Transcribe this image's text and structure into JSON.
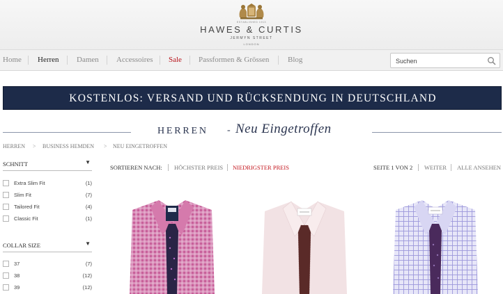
{
  "brand": {
    "established": "ESTABLISHED 1913",
    "name": "HAWES & CURTIS",
    "street": "JERMYN STREET",
    "city": "LONDON"
  },
  "nav": {
    "items": [
      {
        "label": "Home"
      },
      {
        "label": "Herren"
      },
      {
        "label": "Damen"
      },
      {
        "label": "Accessoires"
      },
      {
        "label": "Sale"
      },
      {
        "label": "Passformen & Grössen"
      },
      {
        "label": "Blog"
      }
    ],
    "active": "Herren",
    "search_placeholder": "Suchen"
  },
  "banner": {
    "text": "KOSTENLOS: VERSAND UND RÜCKSENDUNG IN DEUTSCHLAND"
  },
  "page_title": {
    "main": "HERREN",
    "dash": "-",
    "script": "Neu Eingetroffen"
  },
  "breadcrumb": {
    "items": [
      "HERREN",
      "BUSINESS HEMDEN",
      "NEU EINGETROFFEN"
    ],
    "separator": ">"
  },
  "filters": {
    "schnitt": {
      "title": "SCHNITT",
      "options": [
        {
          "label": "Extra Slim Fit",
          "count": "(1)"
        },
        {
          "label": "Slim Fit",
          "count": "(7)"
        },
        {
          "label": "Tailored Fit",
          "count": "(4)"
        },
        {
          "label": "Classic Fit",
          "count": "(1)"
        }
      ]
    },
    "collar": {
      "title": "COLLAR SIZE",
      "options": [
        {
          "label": "37",
          "count": "(7)"
        },
        {
          "label": "38",
          "count": "(12)"
        },
        {
          "label": "39",
          "count": "(12)"
        }
      ]
    },
    "arrow": "▼"
  },
  "sort": {
    "label": "SORTIEREN NACH:",
    "options": [
      "HÖCHSTER PREIS",
      "NIEDRIGSTER PREIS"
    ],
    "active": "NIEDRIGSTER PREIS",
    "page": "SEITE 1 VON 2",
    "next": "WEITER",
    "view_all": "ALLE ANSEHEN"
  },
  "colors": {
    "banner": "#1d2b49",
    "sale": "#b8131a",
    "active_sort": "#c3141c",
    "title": "#2b3550"
  },
  "products": [
    {
      "name": "pink-gingham-shirt",
      "shirt_color": "#c8609a",
      "check_color": "#e8bcd7",
      "tie_color": "#2a2446"
    },
    {
      "name": "light-pink-shirt",
      "shirt_color": "#f2e2e4",
      "check_color": "#f9eff0",
      "tie_color": "#5a2a28"
    },
    {
      "name": "lilac-check-shirt",
      "shirt_color": "#cbc9ee",
      "check_color": "#9d98db",
      "tie_color": "#4a2a5c"
    }
  ]
}
